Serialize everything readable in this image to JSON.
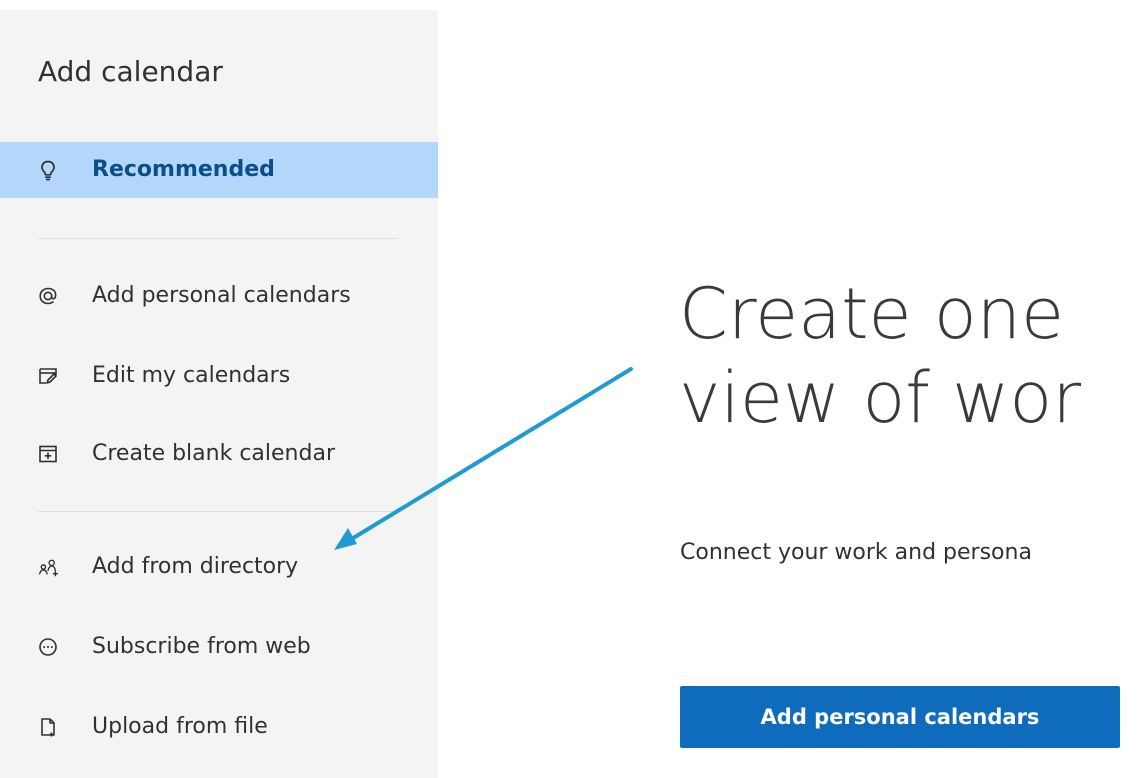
{
  "sidebar": {
    "title": "Add calendar",
    "items": [
      {
        "label": "Recommended",
        "icon": "lightbulb-icon",
        "active": true
      },
      {
        "label": "Add personal calendars",
        "icon": "at-sign-icon",
        "active": false
      },
      {
        "label": "Edit my calendars",
        "icon": "edit-calendar-icon",
        "active": false
      },
      {
        "label": "Create blank calendar",
        "icon": "add-calendar-icon",
        "active": false
      },
      {
        "label": "Add from directory",
        "icon": "people-add-icon",
        "active": false
      },
      {
        "label": "Subscribe from web",
        "icon": "more-circle-icon",
        "active": false
      },
      {
        "label": "Upload from file",
        "icon": "file-upload-icon",
        "active": false
      }
    ]
  },
  "main": {
    "hero_title_line_1": "Create one",
    "hero_title_line_2": "view of wor",
    "hero_subtitle": "Connect your work and persona",
    "primary_button_label": "Add personal calendars"
  },
  "colors": {
    "sidebar_background": "#f4f4f4",
    "selected_background": "#b3d6fb",
    "selected_text": "#0b4f8a",
    "primary_button": "#0f6cbd",
    "annotation_arrow": "#1f9bd3"
  }
}
